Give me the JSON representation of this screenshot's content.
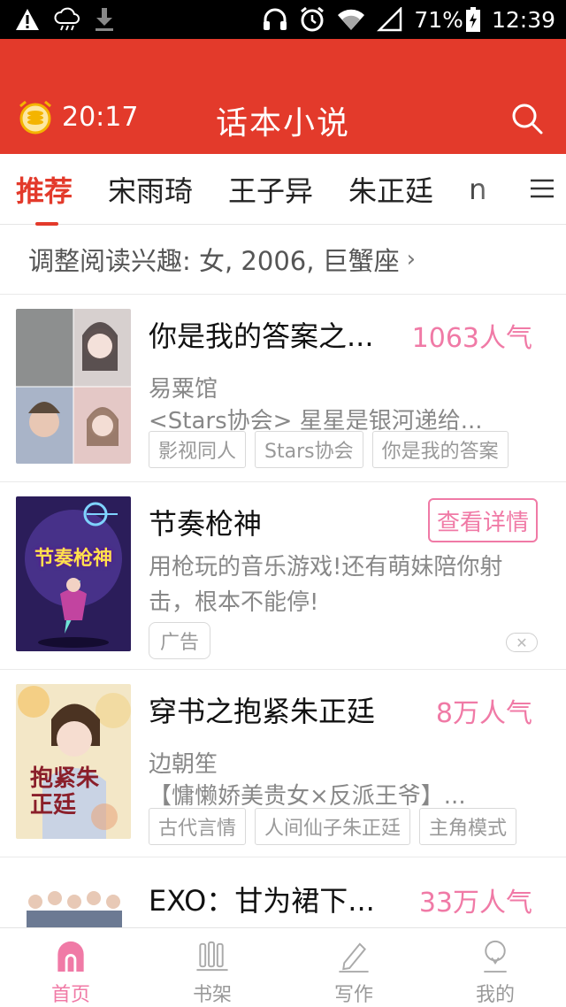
{
  "status_bar": {
    "icons_left": [
      "warning-icon",
      "cloud-rain-icon",
      "download-icon"
    ],
    "icons_right": [
      "headphones-icon",
      "alarm-icon",
      "wifi-icon",
      "signal-icon",
      "battery-icon"
    ],
    "battery": "71%",
    "time": "12:39"
  },
  "header": {
    "timer": "20:17",
    "title": "话本小说",
    "accent": "#e33a2b"
  },
  "tabs": [
    {
      "label": "推荐",
      "active": true
    },
    {
      "label": "宋雨琦",
      "active": false
    },
    {
      "label": "王子异",
      "active": false
    },
    {
      "label": "朱正廷",
      "active": false
    },
    {
      "label": "n",
      "active": false
    }
  ],
  "interest": {
    "label": "调整阅读兴趣: 女, 2006, 巨蟹座"
  },
  "cards": [
    {
      "title": "你是我的答案之...",
      "popularity": "1063人气",
      "author": "易粟馆",
      "description": "<Stars协会> 星星是银河递给...",
      "tags": [
        "影视同人",
        "Stars协会",
        "你是我的答案"
      ]
    },
    {
      "title": "节奏枪神",
      "button": "查看详情",
      "description": "用枪玩的音乐游戏!还有萌妹陪你射击，根本不能停!",
      "ad_label": "广告",
      "cover_text": "节奏枪神"
    },
    {
      "title": "穿书之抱紧朱正廷",
      "popularity": "8万人气",
      "author": "边朝笙",
      "description": "【慵懒娇美贵女×反派王爷】...",
      "tags": [
        "古代言情",
        "人间仙子朱正廷",
        "主角模式"
      ],
      "cover_text": "抱紧朱正廷"
    },
    {
      "title": "EXO：甘为裙下...",
      "popularity": "33万人气"
    }
  ],
  "bottom_nav": [
    {
      "label": "首页",
      "icon": "home-icon",
      "active": true
    },
    {
      "label": "书架",
      "icon": "bookshelf-icon",
      "active": false
    },
    {
      "label": "写作",
      "icon": "pen-icon",
      "active": false
    },
    {
      "label": "我的",
      "icon": "profile-icon",
      "active": false
    }
  ],
  "colors": {
    "pink": "#f07aa6",
    "red": "#e33a2b"
  }
}
